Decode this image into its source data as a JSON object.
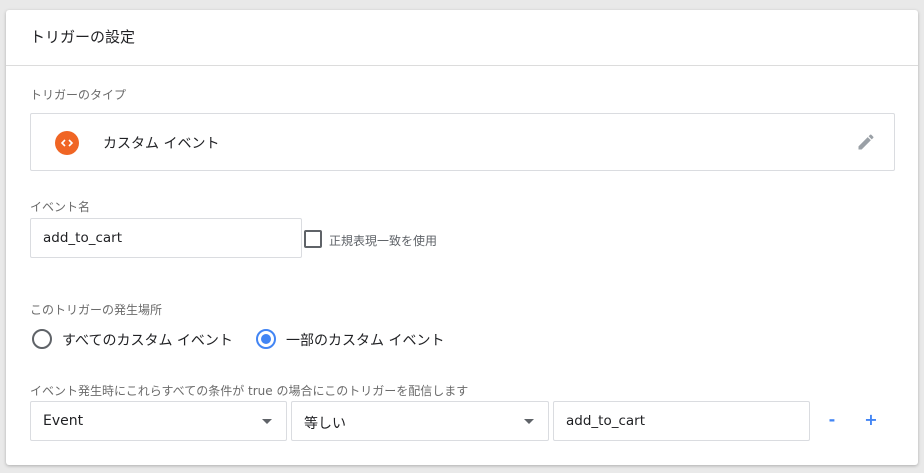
{
  "card": {
    "title": "トリガーの設定"
  },
  "trigger_type": {
    "label": "トリガーのタイプ",
    "value": "カスタム イベント",
    "icon": "custom-event-icon",
    "icon_color": "#f06524"
  },
  "event_name": {
    "label": "イベント名",
    "value": "add_to_cart",
    "regex_label": "正規表現一致を使用",
    "regex_checked": false
  },
  "fire_on": {
    "label": "このトリガーの発生場所",
    "options": [
      "すべてのカスタム イベント",
      "一部のカスタム イベント"
    ],
    "selected": "一部のカスタム イベント"
  },
  "conditions": {
    "label": "イベント発生時にこれらすべての条件が true の場合にこのトリガーを配信します",
    "variable": "Event",
    "operator": "等しい",
    "value": "add_to_cart",
    "remove_label": "-",
    "add_label": "+"
  },
  "colors": {
    "accent": "#4285f4"
  }
}
